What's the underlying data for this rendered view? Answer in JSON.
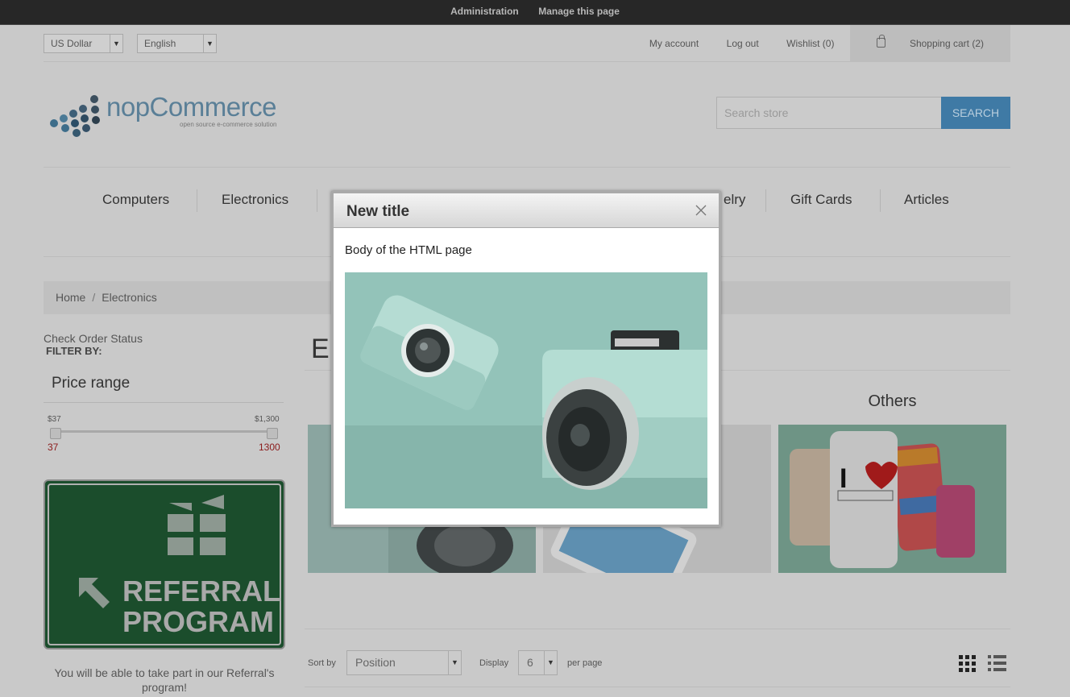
{
  "admin_bar": {
    "administration": "Administration",
    "manage_page": "Manage this page"
  },
  "header": {
    "currency": "US Dollar",
    "language": "English",
    "my_account": "My account",
    "log_out": "Log out",
    "wishlist": "Wishlist (0)",
    "shopping_cart": "Shopping cart (2)"
  },
  "logo": {
    "name": "nopCommerce",
    "tagline": "open source e-commerce solution"
  },
  "search": {
    "placeholder": "Search store",
    "button": "SEARCH"
  },
  "menu": {
    "computers": "Computers",
    "electronics": "Electronics",
    "jewelry_partial": "elry",
    "gift_cards": "Gift Cards",
    "articles": "Articles"
  },
  "breadcrumb": {
    "home": "Home",
    "separator": "/",
    "current": "Electronics"
  },
  "sidebar": {
    "check_order": "Check Order Status",
    "filter_by": "FILTER BY:",
    "price_range_title": "Price range",
    "price_min_label": "$37",
    "price_max_label": "$1,300",
    "price_min_value": "37",
    "price_max_value": "1300",
    "referral_line1": "REFERRAL",
    "referral_line2": "PROGRAM",
    "referral_text_1": "You will be able to take part in our Referral's",
    "referral_text_2": "program!"
  },
  "content": {
    "page_title_partial": "E",
    "others": "Others",
    "sort_by_label": "Sort by",
    "sort_value": "Position",
    "display_label": "Display",
    "display_value": "6",
    "per_page_label": "per page"
  },
  "modal": {
    "title": "New title",
    "body": "Body of the HTML page"
  },
  "colors": {
    "accent": "#4a90c8",
    "referral_green": "#2e8a4c",
    "admin_bar": "#272727"
  },
  "icons": [
    "shopping-cart-icon",
    "close-icon",
    "gift-icon",
    "arrow-icon",
    "grid-view-icon",
    "list-view-icon",
    "chevron-down-icon"
  ]
}
